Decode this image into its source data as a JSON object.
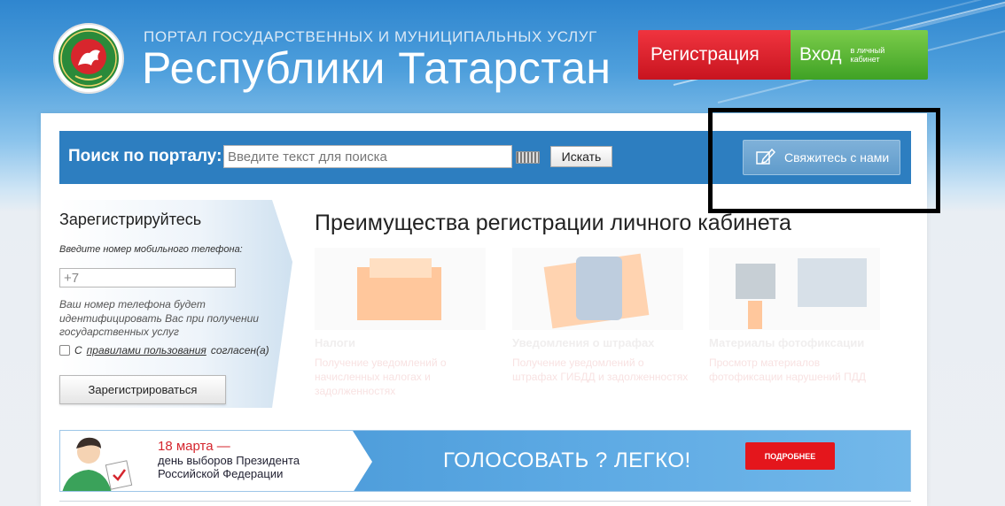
{
  "header": {
    "caption": "ПОРТАЛ ГОСУДАРСТВЕННЫХ И МУНИЦИПАЛЬНЫХ УСЛУГ",
    "title": "Республики Татарстан",
    "emblem_icon": "tatarstan-emblem-icon",
    "register_label": "Регистрация",
    "login_label": "Вход",
    "login_sub": "в личный кабинет"
  },
  "search": {
    "label": "Поиск по порталу:",
    "placeholder": "Введите текст для поиска",
    "value": "",
    "keyboard_icon": "keyboard-icon",
    "button_label": "Искать"
  },
  "contact": {
    "label": "Свяжитесь с нами",
    "icon": "edit-pencil-icon"
  },
  "registration": {
    "title": "Зарегистрируйтесь",
    "phone_label": "Введите номер мобильного телефона:",
    "phone_placeholder": "+7",
    "note": "Ваш номер телефона будет идентифицировать Вас при получении государственных услуг",
    "agree_prefix": "С",
    "agree_link": "правилами пользования",
    "agree_suffix": "согласен(а)",
    "agree_checked": false,
    "submit_label": "Зарегистрироваться"
  },
  "benefits": {
    "title": "Преимущества регистрации личного кабинета",
    "items": [
      {
        "name": "Налоги",
        "desc": "Получение уведомлений о начисленных налогах и задолженностях"
      },
      {
        "name": "Уведомления о штрафах",
        "desc": "Получение уведомлений о штрафах ГИБДД и задолженностях"
      },
      {
        "name": "Материалы фотофиксации",
        "desc": "Просмотр материалов фотофиксации нарушений ПДД"
      }
    ]
  },
  "banner": {
    "date": "18 марта —",
    "line1": "день выборов Президента",
    "line2": "Российской Федерации",
    "slogan": "ГОЛОСОВАТЬ ? ЛЕГКО!",
    "more_label": "ПОДРОБНЕЕ"
  },
  "colors": {
    "register": "#d41c27",
    "login": "#4fb02e",
    "search_bar": "#2d7ec0",
    "banner_accent": "#e4161c"
  }
}
